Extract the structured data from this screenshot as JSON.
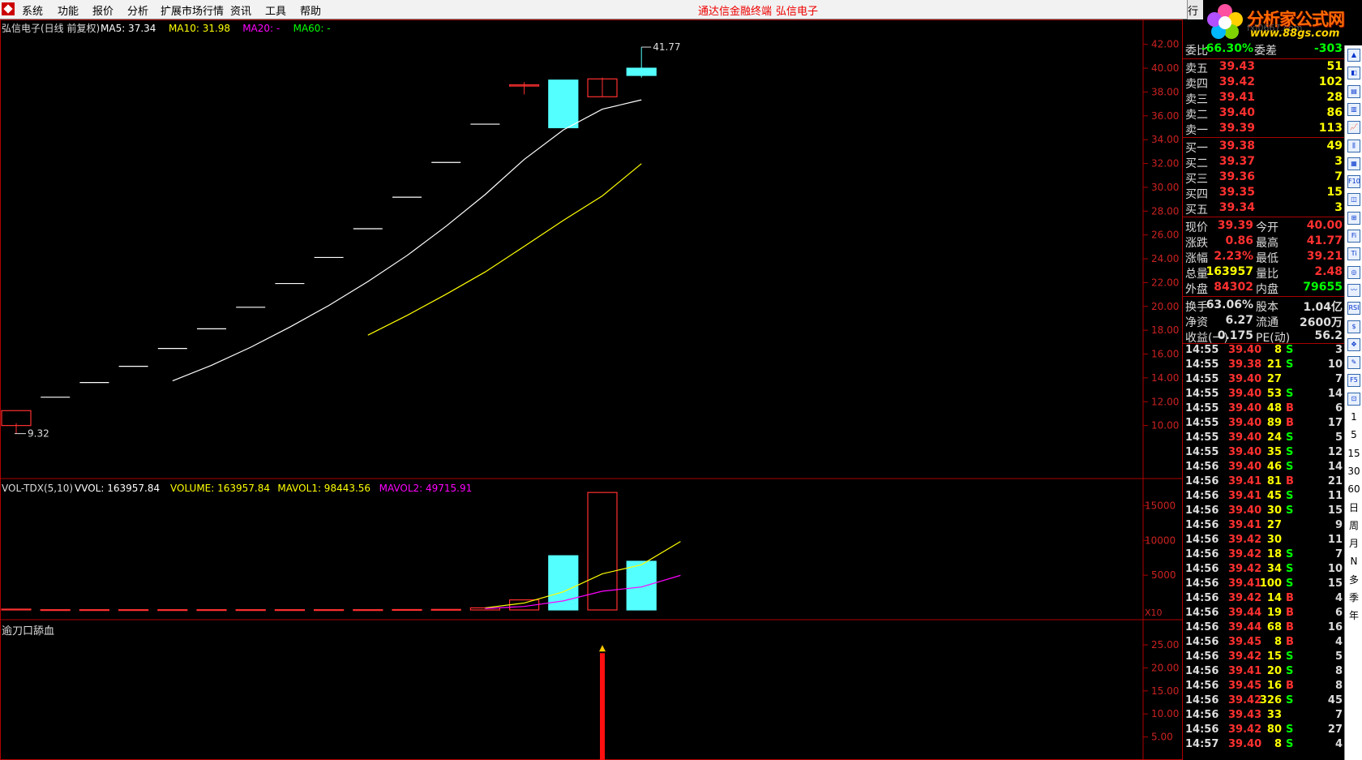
{
  "menu": {
    "items": [
      "系统",
      "功能",
      "报价",
      "分析",
      "扩展市场行情",
      "资讯",
      "工具",
      "帮助"
    ],
    "center_title": "通达信金融终端",
    "stock_title": "弘信电子",
    "right_tab": "行"
  },
  "logo": {
    "brand": "分析家公式网",
    "url": "www.88gs.com",
    "faint": "fxj0667.com"
  },
  "chart": {
    "title": "弘信电子(日线 前复权)",
    "ma_labels": [
      {
        "text": "MA5: 37.34",
        "color": "#ffffff"
      },
      {
        "text": "MA10: 31.98",
        "color": "#ffff00"
      },
      {
        "text": "MA20: -",
        "color": "#ff00ff"
      },
      {
        "text": "MA60: -",
        "color": "#00ff00"
      }
    ],
    "high_label": "41.77",
    "low_label": "9.32",
    "price_ticks": [
      "42.00",
      "40.00",
      "38.00",
      "36.00",
      "34.00",
      "32.00",
      "30.00",
      "28.00",
      "26.00",
      "24.00",
      "22.00",
      "20.00",
      "18.00",
      "16.00",
      "14.00",
      "12.00",
      "10.00"
    ],
    "vol_title": "VOL-TDX(5,10)",
    "vol_labels": [
      {
        "text": "VVOL: 163957.84",
        "color": "#ffffff"
      },
      {
        "text": "VOLUME: 163957.84",
        "color": "#ffff00"
      },
      {
        "text": "MAVOL1: 98443.56",
        "color": "#ffff00"
      },
      {
        "text": "MAVOL2: 49715.91",
        "color": "#ff00ff"
      }
    ],
    "vol_ticks": [
      "15000",
      "10000",
      "5000"
    ],
    "vol_unit": "X10",
    "ind_title": "逾刀口舔血",
    "ind_ticks": [
      "25.00",
      "20.00",
      "15.00",
      "10.00",
      "5.00"
    ]
  },
  "chart_data": [
    {
      "type": "candlestick",
      "title": "弘信电子(日线 前复权)",
      "x": [
        1,
        2,
        3,
        4,
        5,
        6,
        7,
        8,
        9,
        10,
        11,
        12,
        13,
        14,
        15,
        16,
        17
      ],
      "open": [
        10.0,
        12.38,
        13.61,
        14.97,
        16.47,
        18.12,
        19.93,
        21.92,
        24.11,
        26.52,
        29.17,
        32.09,
        35.3,
        38.5,
        39.0,
        37.6,
        40.0
      ],
      "high": [
        10.2,
        12.38,
        13.61,
        14.97,
        16.47,
        18.12,
        19.93,
        21.92,
        24.11,
        26.52,
        29.17,
        32.09,
        35.3,
        38.83,
        39.0,
        39.2,
        41.77
      ],
      "low": [
        9.32,
        12.38,
        13.61,
        14.97,
        16.47,
        18.12,
        19.93,
        21.92,
        24.11,
        26.52,
        29.17,
        32.09,
        35.3,
        37.8,
        35.0,
        37.6,
        39.21
      ],
      "close": [
        11.25,
        12.38,
        13.61,
        14.97,
        16.47,
        18.12,
        19.93,
        21.92,
        24.11,
        26.52,
        29.17,
        32.09,
        35.3,
        38.6,
        35.0,
        39.1,
        39.39
      ],
      "ma5": [
        null,
        null,
        null,
        null,
        13.75,
        15.06,
        16.57,
        18.26,
        20.08,
        22.09,
        24.27,
        26.73,
        29.39,
        32.34,
        34.81,
        36.56,
        37.34
      ],
      "ma10": [
        null,
        null,
        null,
        null,
        null,
        null,
        null,
        null,
        null,
        17.59,
        19.24,
        21.02,
        22.89,
        25.04,
        27.22,
        29.28,
        31.98
      ],
      "ylim": [
        8.0,
        43.0
      ]
    },
    {
      "type": "bar",
      "title": "VOL-TDX(5,10)",
      "x": [
        1,
        2,
        3,
        4,
        5,
        6,
        7,
        8,
        9,
        10,
        11,
        12,
        13,
        14,
        15,
        16,
        17
      ],
      "values": [
        120,
        40,
        40,
        40,
        40,
        40,
        40,
        40,
        40,
        40,
        60,
        80,
        300,
        1450,
        7800,
        16900,
        7000,
        16396
      ],
      "mavol1": [
        null,
        null,
        null,
        null,
        null,
        null,
        null,
        null,
        null,
        null,
        null,
        null,
        300,
        1000,
        2600,
        5200,
        6500,
        9844
      ],
      "mavol2": [
        null,
        null,
        null,
        null,
        null,
        null,
        null,
        null,
        null,
        null,
        null,
        null,
        200,
        500,
        1300,
        2700,
        3300,
        4972
      ],
      "ylim": [
        0,
        17500
      ]
    },
    {
      "type": "bar",
      "title": "逾刀口舔血",
      "x": [
        16
      ],
      "values": [
        23.2
      ],
      "ylim": [
        0,
        28
      ]
    }
  ],
  "quote": {
    "weibi": {
      "label": "委比",
      "value": "-66.30%",
      "label2": "委差",
      "value2": "-303"
    },
    "sell": [
      {
        "label": "卖五",
        "price": "39.43",
        "vol": "51"
      },
      {
        "label": "卖四",
        "price": "39.42",
        "vol": "102"
      },
      {
        "label": "卖三",
        "price": "39.41",
        "vol": "28"
      },
      {
        "label": "卖二",
        "price": "39.40",
        "vol": "86"
      },
      {
        "label": "卖一",
        "price": "39.39",
        "vol": "113"
      }
    ],
    "buy": [
      {
        "label": "买一",
        "price": "39.38",
        "vol": "49"
      },
      {
        "label": "买二",
        "price": "39.37",
        "vol": "3"
      },
      {
        "label": "买三",
        "price": "39.36",
        "vol": "7"
      },
      {
        "label": "买四",
        "price": "39.35",
        "vol": "15"
      },
      {
        "label": "买五",
        "price": "39.34",
        "vol": "3"
      }
    ],
    "stats": [
      {
        "l1": "现价",
        "v1": "39.39",
        "c1": "#ff3030",
        "l2": "今开",
        "v2": "40.00",
        "c2": "#ff3030"
      },
      {
        "l1": "涨跌",
        "v1": "0.86",
        "c1": "#ff3030",
        "l2": "最高",
        "v2": "41.77",
        "c2": "#ff3030"
      },
      {
        "l1": "涨幅",
        "v1": "2.23%",
        "c1": "#ff3030",
        "l2": "最低",
        "v2": "39.21",
        "c2": "#ff3030"
      },
      {
        "l1": "总量",
        "v1": "163957",
        "c1": "#ffff00",
        "l2": "量比",
        "v2": "2.48",
        "c2": "#ff3030"
      },
      {
        "l1": "外盘",
        "v1": "84302",
        "c1": "#ff3030",
        "l2": "内盘",
        "v2": "79655",
        "c2": "#00ff00"
      }
    ],
    "stats2": [
      {
        "l1": "换手",
        "v1": "63.06%",
        "l2": "股本",
        "v2": "1.04亿"
      },
      {
        "l1": "净资",
        "v1": "6.27",
        "l2": "流通",
        "v2": "2600万"
      },
      {
        "l1": "收益(一)",
        "v1": "0.175",
        "l2": "PE(动)",
        "v2": "56.2"
      }
    ]
  },
  "ticks": [
    {
      "t": "14:55",
      "p": "39.40",
      "v": "8",
      "d": "S",
      "n": "3"
    },
    {
      "t": "14:55",
      "p": "39.38",
      "v": "21",
      "d": "S",
      "n": "10"
    },
    {
      "t": "14:55",
      "p": "39.40",
      "v": "27",
      "d": "",
      "n": "7"
    },
    {
      "t": "14:55",
      "p": "39.40",
      "v": "53",
      "d": "S",
      "n": "14"
    },
    {
      "t": "14:55",
      "p": "39.40",
      "v": "48",
      "d": "B",
      "n": "6"
    },
    {
      "t": "14:55",
      "p": "39.40",
      "v": "89",
      "d": "B",
      "n": "17"
    },
    {
      "t": "14:55",
      "p": "39.40",
      "v": "24",
      "d": "S",
      "n": "5"
    },
    {
      "t": "14:55",
      "p": "39.40",
      "v": "35",
      "d": "S",
      "n": "12"
    },
    {
      "t": "14:56",
      "p": "39.40",
      "v": "46",
      "d": "S",
      "n": "14"
    },
    {
      "t": "14:56",
      "p": "39.41",
      "v": "81",
      "d": "B",
      "n": "21"
    },
    {
      "t": "14:56",
      "p": "39.41",
      "v": "45",
      "d": "S",
      "n": "11"
    },
    {
      "t": "14:56",
      "p": "39.40",
      "v": "30",
      "d": "S",
      "n": "15"
    },
    {
      "t": "14:56",
      "p": "39.41",
      "v": "27",
      "d": "",
      "n": "9"
    },
    {
      "t": "14:56",
      "p": "39.42",
      "v": "30",
      "d": "",
      "n": "11"
    },
    {
      "t": "14:56",
      "p": "39.42",
      "v": "18",
      "d": "S",
      "n": "7"
    },
    {
      "t": "14:56",
      "p": "39.42",
      "v": "34",
      "d": "S",
      "n": "10"
    },
    {
      "t": "14:56",
      "p": "39.41",
      "v": "100",
      "d": "S",
      "n": "15"
    },
    {
      "t": "14:56",
      "p": "39.42",
      "v": "14",
      "d": "B",
      "n": "4"
    },
    {
      "t": "14:56",
      "p": "39.44",
      "v": "19",
      "d": "B",
      "n": "6"
    },
    {
      "t": "14:56",
      "p": "39.44",
      "v": "68",
      "d": "B",
      "n": "16"
    },
    {
      "t": "14:56",
      "p": "39.45",
      "v": "8",
      "d": "B",
      "n": "4"
    },
    {
      "t": "14:56",
      "p": "39.42",
      "v": "15",
      "d": "S",
      "n": "5"
    },
    {
      "t": "14:56",
      "p": "39.41",
      "v": "20",
      "d": "S",
      "n": "8"
    },
    {
      "t": "14:56",
      "p": "39.45",
      "v": "16",
      "d": "B",
      "n": "8"
    },
    {
      "t": "14:56",
      "p": "39.42",
      "v": "326",
      "d": "S",
      "n": "45"
    },
    {
      "t": "14:56",
      "p": "39.43",
      "v": "33",
      "d": "",
      "n": "7"
    },
    {
      "t": "14:56",
      "p": "39.42",
      "v": "80",
      "d": "S",
      "n": "27"
    },
    {
      "t": "14:57",
      "p": "39.40",
      "v": "8",
      "d": "S",
      "n": "4"
    }
  ],
  "toolbar": [
    "▲",
    "◧",
    "▤",
    "▥",
    "📈",
    "⫼",
    "▦",
    "F10",
    "◫",
    "⊞",
    "Fi",
    "Ti",
    "◎",
    "〰",
    "RSI",
    "$",
    "✥",
    "✎",
    "F5",
    "⊡",
    "1",
    "5",
    "15",
    "30",
    "60",
    "日",
    "周",
    "月",
    "N",
    "多",
    "季",
    "年"
  ],
  "colors": {
    "up": "#ff3030",
    "down": "#54ffff",
    "axis": "#b00000",
    "ma5": "#ffffff",
    "ma10": "#ffff00",
    "mavol2": "#ff00ff"
  }
}
